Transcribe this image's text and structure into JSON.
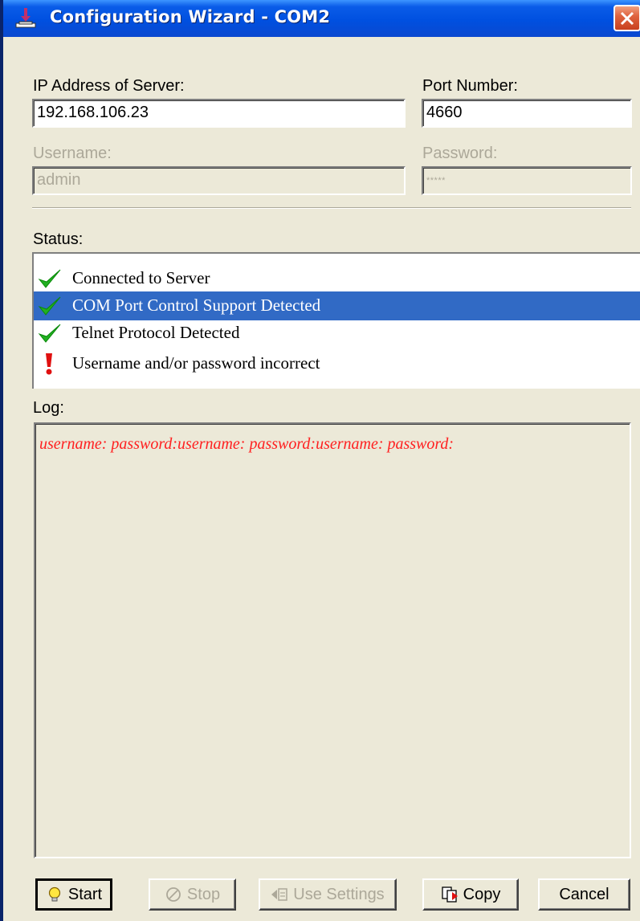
{
  "window": {
    "title": "Configuration Wizard - COM2",
    "icons": {
      "app": "port-plug-icon",
      "close": "close-icon"
    },
    "colors": {
      "titlebar": "#0054e3",
      "close": "#e06440",
      "face": "#ece9d8",
      "selection": "#316ac5"
    }
  },
  "server": {
    "ip_label": "IP Address of Server:",
    "ip_value": "192.168.106.23",
    "port_label": "Port Number:",
    "port_value": "4660"
  },
  "credentials": {
    "username_label": "Username:",
    "username_value": "admin",
    "password_label": "Password:",
    "password_value": "*****"
  },
  "status": {
    "label": "Status:",
    "items": [
      {
        "text": "Connected to Server",
        "icon": "green-check-icon",
        "selected": false
      },
      {
        "text": "COM Port Control Support Detected",
        "icon": "green-check-icon",
        "selected": true
      },
      {
        "text": "Telnet Protocol Detected",
        "icon": "green-check-icon",
        "selected": false
      },
      {
        "text": "Username and/or password incorrect",
        "icon": "red-exclamation-icon",
        "selected": false
      }
    ]
  },
  "log": {
    "label": "Log:",
    "text": "username: password:username: password:username: password:",
    "text_color": "#ff2020"
  },
  "buttons": {
    "start": "Start",
    "stop": "Stop",
    "use_settings": "Use Settings",
    "copy": "Copy",
    "cancel": "Cancel"
  }
}
